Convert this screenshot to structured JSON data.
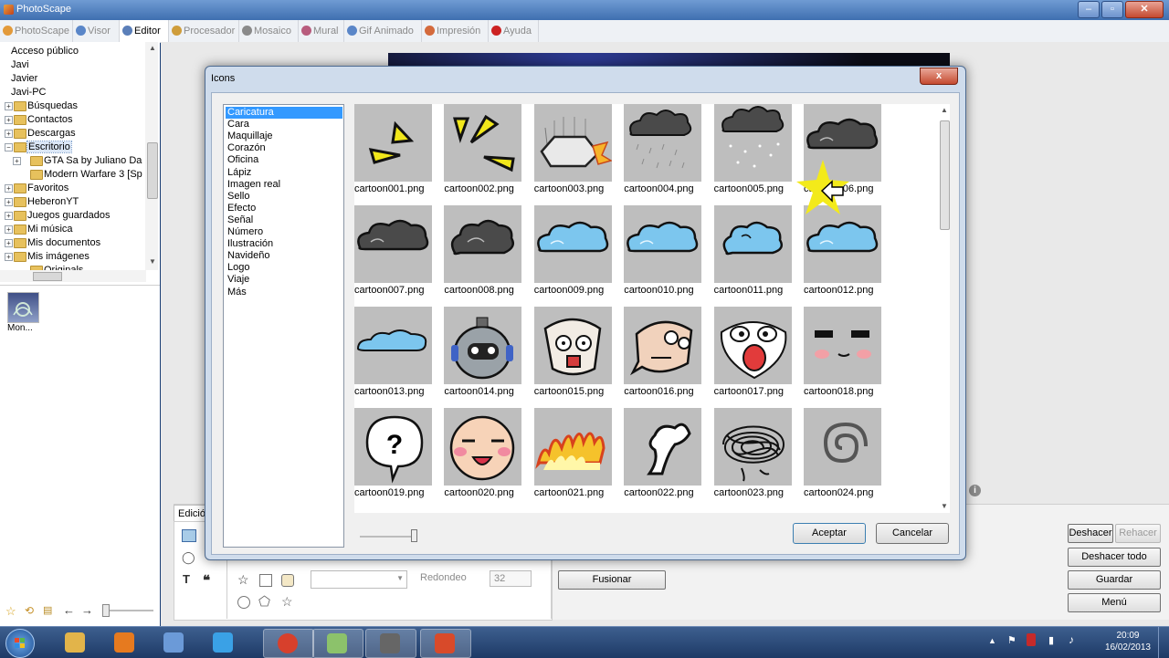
{
  "app": {
    "title": "PhotoScape"
  },
  "menu": {
    "tabs": [
      {
        "label": "PhotoScape",
        "active": false,
        "icon": "photoscape-icon",
        "color": "#e39a3a"
      },
      {
        "label": "Visor",
        "active": false,
        "icon": "viewer-icon",
        "color": "#5a86c8"
      },
      {
        "label": "Editor",
        "active": true,
        "icon": "editor-icon",
        "color": "#5b7fb9"
      },
      {
        "label": "Procesador",
        "active": false,
        "icon": "batch-icon",
        "color": "#cf9d3b"
      },
      {
        "label": "Mosaico",
        "active": false,
        "icon": "page-icon",
        "color": "#8a8a8a"
      },
      {
        "label": "Mural",
        "active": false,
        "icon": "combine-icon",
        "color": "#b85c7d"
      },
      {
        "label": "Gif Animado",
        "active": false,
        "icon": "gif-icon",
        "color": "#5a86c8"
      },
      {
        "label": "Impresión",
        "active": false,
        "icon": "print-icon",
        "color": "#d46a3c"
      },
      {
        "label": "Ayuda",
        "active": false,
        "icon": "help-icon",
        "color": "#cc2222"
      }
    ]
  },
  "tree": {
    "items": [
      {
        "label": "Acceso público",
        "folder": false
      },
      {
        "label": "Javi",
        "folder": false
      },
      {
        "label": "Javier",
        "folder": false
      },
      {
        "label": "Javi-PC",
        "folder": false
      },
      {
        "label": "Búsquedas",
        "folder": true
      },
      {
        "label": "Contactos",
        "folder": true
      },
      {
        "label": "Descargas",
        "folder": true
      },
      {
        "label": "Escritorio",
        "folder": true,
        "selected": true
      },
      {
        "label": "GTA Sa by Juliano Da",
        "folder": true,
        "child": true
      },
      {
        "label": "Modern Warfare 3 [Sp",
        "folder": true,
        "child": true
      },
      {
        "label": "Favoritos",
        "folder": true
      },
      {
        "label": "HeberonYT",
        "folder": true
      },
      {
        "label": "Juegos guardados",
        "folder": true
      },
      {
        "label": "Mi música",
        "folder": true
      },
      {
        "label": "Mis documentos",
        "folder": true
      },
      {
        "label": "Mis imágenes",
        "folder": true
      },
      {
        "label": "Originals",
        "folder": true,
        "child": true
      }
    ],
    "thumb_label": "Mon..."
  },
  "bottom": {
    "tab_label": "Edició",
    "redondeo_label": "Redondeo",
    "redondeo_value": "32",
    "fusionar_label": "Fusionar",
    "right_buttons": {
      "deshacer": "Deshacer",
      "rehacer": "Rehacer",
      "deshacer_todo": "Deshacer todo",
      "guardar": "Guardar",
      "menu": "Menú"
    }
  },
  "dialog": {
    "title": "Icons",
    "close": "x",
    "categories": [
      "Caricatura",
      "Cara",
      "Maquillaje",
      "Corazón",
      "Oficina",
      "Lápiz",
      "Imagen real",
      "Sello",
      "Efecto",
      "Señal",
      "Número",
      "Ilustración",
      "Navideño",
      "Logo",
      "Viaje",
      "Más"
    ],
    "selected_category": "Caricatura",
    "icons": [
      {
        "name": "cartoon001.png",
        "art": "flash1"
      },
      {
        "name": "cartoon002.png",
        "art": "flash2"
      },
      {
        "name": "cartoon003.png",
        "art": "rock"
      },
      {
        "name": "cartoon004.png",
        "art": "rain"
      },
      {
        "name": "cartoon005.png",
        "art": "snow"
      },
      {
        "name": "cartoon006.png",
        "art": "darkcloud"
      },
      {
        "name": "cartoon007.png",
        "art": "darkcloud"
      },
      {
        "name": "cartoon008.png",
        "art": "darkcloud2"
      },
      {
        "name": "cartoon009.png",
        "art": "bluecloud"
      },
      {
        "name": "cartoon010.png",
        "art": "bluecloud"
      },
      {
        "name": "cartoon011.png",
        "art": "bluecloud2"
      },
      {
        "name": "cartoon012.png",
        "art": "bluecloud"
      },
      {
        "name": "cartoon013.png",
        "art": "bluecloud3"
      },
      {
        "name": "cartoon014.png",
        "art": "robot"
      },
      {
        "name": "cartoon015.png",
        "art": "face1"
      },
      {
        "name": "cartoon016.png",
        "art": "face2"
      },
      {
        "name": "cartoon017.png",
        "art": "face3"
      },
      {
        "name": "cartoon018.png",
        "art": "face4"
      },
      {
        "name": "cartoon019.png",
        "art": "question"
      },
      {
        "name": "cartoon020.png",
        "art": "face5"
      },
      {
        "name": "cartoon021.png",
        "art": "fire"
      },
      {
        "name": "cartoon022.png",
        "art": "bubble"
      },
      {
        "name": "cartoon023.png",
        "art": "scribble"
      },
      {
        "name": "cartoon024.png",
        "art": "spiral"
      }
    ],
    "accept_label": "Aceptar",
    "cancel_label": "Cancelar"
  },
  "taskbar": {
    "time": "20:09",
    "date": "16/02/2013",
    "apps": [
      {
        "name": "explorer-icon",
        "color": "#e2b44a"
      },
      {
        "name": "media-player-icon",
        "color": "#e67a1f"
      },
      {
        "name": "paint-icon",
        "color": "#6b9ad8"
      },
      {
        "name": "steam-icon",
        "color": "#3aa1e6"
      },
      {
        "name": "chrome-icon",
        "color": "#d7402c"
      },
      {
        "name": "notes-icon",
        "color": "#8cc26b"
      },
      {
        "name": "camera-icon",
        "color": "#666666"
      },
      {
        "name": "photoscape-task-icon",
        "color": "#d84a2a"
      }
    ]
  }
}
